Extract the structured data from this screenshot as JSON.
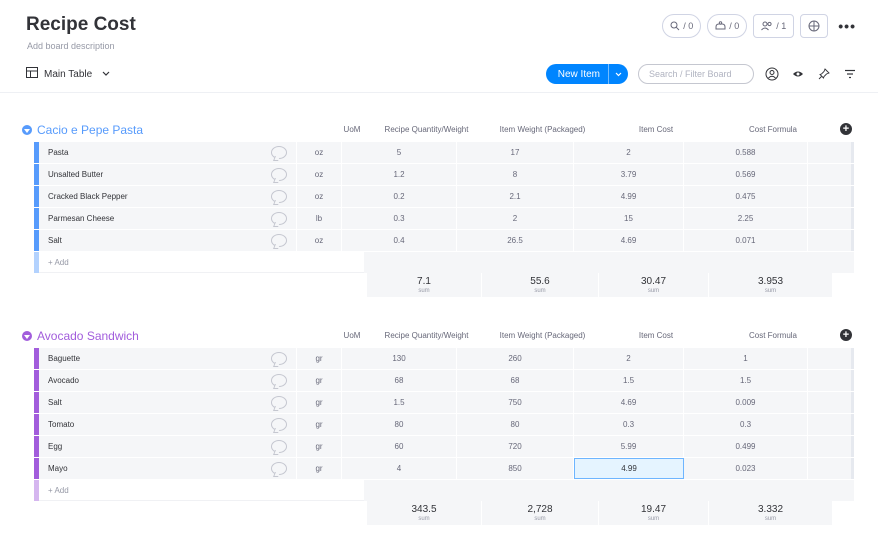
{
  "board": {
    "title": "Recipe Cost",
    "description": "Add board description"
  },
  "top_actions": {
    "search_count": "/ 0",
    "integrations_count": "/ 0",
    "members_count": "/ 1"
  },
  "toolbar": {
    "view_label": "Main Table",
    "new_item_label": "New Item",
    "search_placeholder": "Search / Filter Board"
  },
  "columns": {
    "uom": "UoM",
    "qty": "Recipe Quantity/Weight",
    "weight": "Item Weight (Packaged)",
    "cost": "Item Cost",
    "formula": "Cost Formula"
  },
  "add_label": "+ Add",
  "sum_label": "sum",
  "groups": [
    {
      "title": "Cacio e Pepe Pasta",
      "color": "#579bfc",
      "rows": [
        {
          "name": "Pasta",
          "uom": "oz",
          "qty": "5",
          "weight": "17",
          "cost": "2",
          "formula": "0.588"
        },
        {
          "name": "Unsalted Butter",
          "uom": "oz",
          "qty": "1.2",
          "weight": "8",
          "cost": "3.79",
          "formula": "0.569"
        },
        {
          "name": "Cracked Black Pepper",
          "uom": "oz",
          "qty": "0.2",
          "weight": "2.1",
          "cost": "4.99",
          "formula": "0.475"
        },
        {
          "name": "Parmesan Cheese",
          "uom": "lb",
          "qty": "0.3",
          "weight": "2",
          "cost": "15",
          "formula": "2.25"
        },
        {
          "name": "Salt",
          "uom": "oz",
          "qty": "0.4",
          "weight": "26.5",
          "cost": "4.69",
          "formula": "0.071"
        }
      ],
      "sums": {
        "qty": "7.1",
        "weight": "55.6",
        "cost": "30.47",
        "formula": "3.953"
      }
    },
    {
      "title": "Avocado Sandwich",
      "color": "#a25ddc",
      "rows": [
        {
          "name": "Baguette",
          "uom": "gr",
          "qty": "130",
          "weight": "260",
          "cost": "2",
          "formula": "1"
        },
        {
          "name": "Avocado",
          "uom": "gr",
          "qty": "68",
          "weight": "68",
          "cost": "1.5",
          "formula": "1.5"
        },
        {
          "name": "Salt",
          "uom": "gr",
          "qty": "1.5",
          "weight": "750",
          "cost": "4.69",
          "formula": "0.009"
        },
        {
          "name": "Tomato",
          "uom": "gr",
          "qty": "80",
          "weight": "80",
          "cost": "0.3",
          "formula": "0.3"
        },
        {
          "name": "Egg",
          "uom": "gr",
          "qty": "60",
          "weight": "720",
          "cost": "5.99",
          "formula": "0.499"
        },
        {
          "name": "Mayo",
          "uom": "gr",
          "qty": "4",
          "weight": "850",
          "cost": "4.99",
          "formula": "0.023"
        }
      ],
      "sums": {
        "qty": "343.5",
        "weight": "2,728",
        "cost": "19.47",
        "formula": "3.332"
      }
    }
  ]
}
